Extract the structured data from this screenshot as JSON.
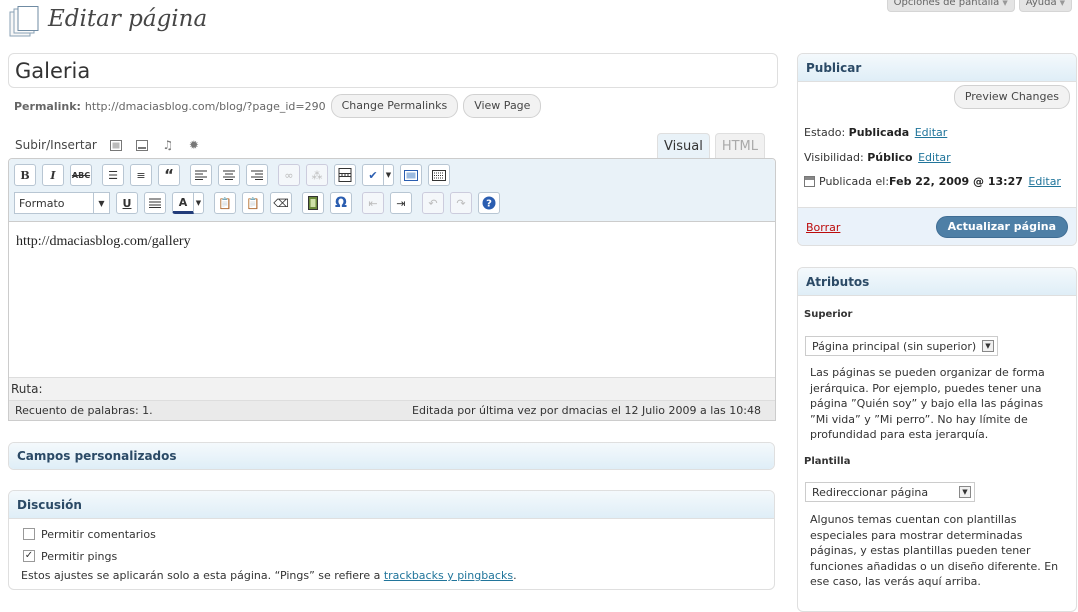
{
  "screen_tabs": {
    "screen_options": "Opciones de pantalla",
    "help": "Ayuda"
  },
  "header": {
    "title": "Editar página"
  },
  "post": {
    "title": "Galeria",
    "permalink_label": "Permalink:",
    "permalink_url": "http://dmaciasblog.com/blog/?page_id=290",
    "change_permalinks": "Change Permalinks",
    "view_page": "View Page"
  },
  "media": {
    "label": "Subir/Insertar"
  },
  "editor": {
    "tab_visual": "Visual",
    "tab_html": "HTML",
    "format_select": "Formato",
    "content": "http://dmaciasblog.com/gallery",
    "path_label": "Ruta:",
    "word_count": "Recuento de palabras: 1.",
    "last_edited": "Editada por última vez por dmacias el 12 Julio 2009 a las 10:48"
  },
  "custom_fields": {
    "title": "Campos personalizados"
  },
  "discussion": {
    "title": "Discusión",
    "allow_comments": "Permitir comentarios",
    "allow_comments_checked": false,
    "allow_pings": "Permitir pings",
    "allow_pings_checked": true,
    "note_prefix": "Estos ajustes se aplicarán solo a esta página. “Pings” se refiere a ",
    "note_link": "trackbacks y pingbacks",
    "note_suffix": "."
  },
  "publish": {
    "title": "Publicar",
    "preview": "Preview Changes",
    "status_label": "Estado:",
    "status_value": "Publicada",
    "visibility_label": "Visibilidad:",
    "visibility_value": "Público",
    "published_label": "Publicada el:",
    "published_value": "Feb 22, 2009 @ 13:27",
    "edit": "Editar",
    "delete": "Borrar",
    "update": "Actualizar página"
  },
  "attributes": {
    "title": "Atributos",
    "parent_label": "Superior",
    "parent_value": "Página principal (sin superior)",
    "parent_help": "Las páginas se pueden organizar de forma jerárquica. Por ejemplo, puedes tener una página ”Quién soy” y bajo ella las páginas ”Mi vida” y ”Mi perro”. No hay límite de profundidad para esta jerarquía.",
    "template_label": "Plantilla",
    "template_value": "Redireccionar página",
    "template_help": "Algunos temas cuentan con plantillas especiales para mostrar determinadas páginas, y estas plantillas pueden tener funciones añadidas o un diseño diferente. En ese caso, las verás aquí arriba."
  },
  "toolbar_icons": {
    "row1": [
      "bold-icon",
      "italic-icon",
      "strikethrough-icon",
      "bullet-list-icon",
      "numbered-list-icon",
      "blockquote-icon",
      "align-left-icon",
      "align-center-icon",
      "align-right-icon",
      "link-icon",
      "unlink-icon",
      "more-tag-icon",
      "spellcheck-icon",
      "fullscreen-icon",
      "kitchen-sink-icon"
    ],
    "row2": [
      "underline-icon",
      "justify-icon",
      "text-color-icon",
      "paste-text-icon",
      "paste-word-icon",
      "remove-format-icon",
      "media-icon",
      "special-char-icon",
      "outdent-icon",
      "indent-icon",
      "undo-icon",
      "redo-icon",
      "help-icon"
    ]
  },
  "colors": {
    "accent": "#21759b",
    "update_button": "#4e7fa6",
    "delete": "#bc0b0b",
    "toolbar_bg": "#e9f2f8"
  }
}
